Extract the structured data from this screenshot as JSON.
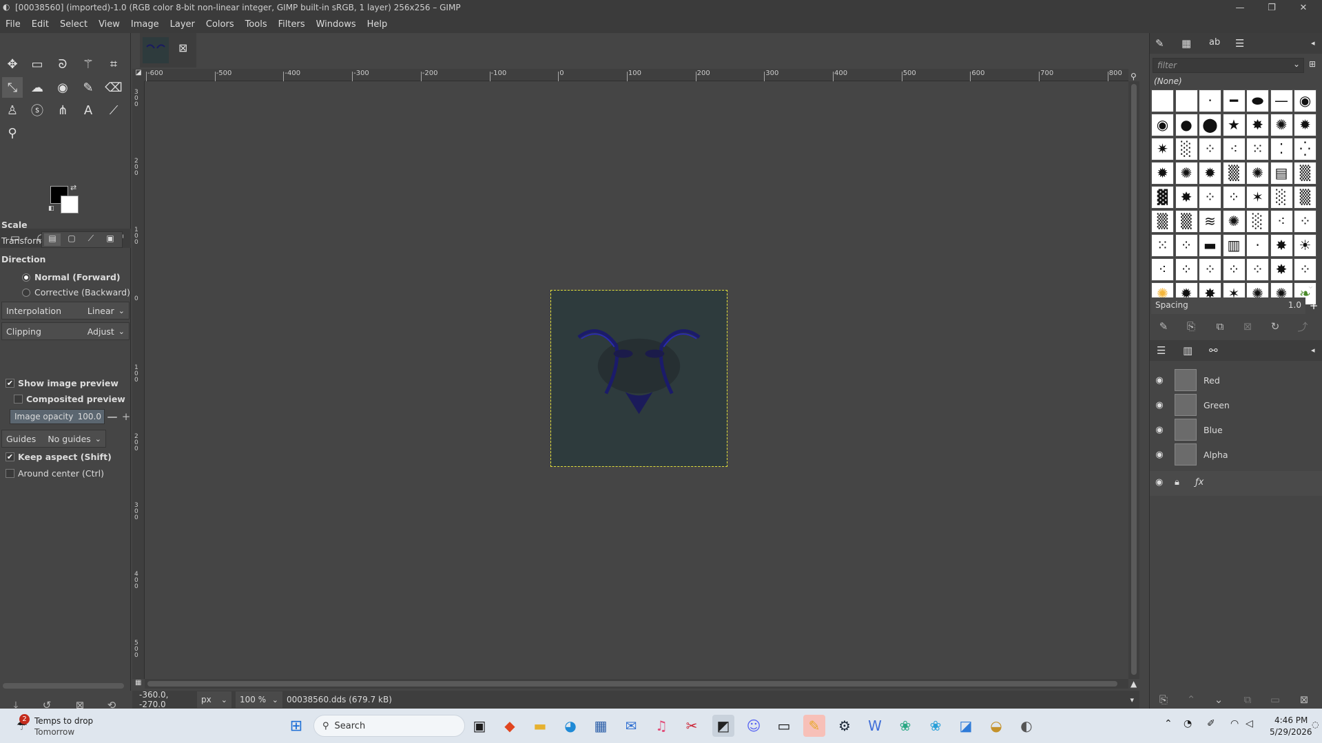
{
  "window": {
    "title": "[00038560] (imported)-1.0 (RGB color 8-bit non-linear integer, GIMP built-in sRGB, 1 layer) 256x256 – GIMP",
    "minimize": "—",
    "maximize": "❐",
    "close": "✕"
  },
  "menu": [
    "File",
    "Edit",
    "Select",
    "View",
    "Image",
    "Layer",
    "Colors",
    "Tools",
    "Filters",
    "Windows",
    "Help"
  ],
  "tool_options": {
    "title": "Scale",
    "transform_label": "Transform:",
    "direction_label": "Direction",
    "direction_normal": "Normal (Forward)",
    "direction_corrective": "Corrective (Backward)",
    "interpolation_label": "Interpolation",
    "interpolation_value": "Linear",
    "clipping_label": "Clipping",
    "clipping_value": "Adjust",
    "show_preview": "Show image preview",
    "composited_preview": "Composited preview",
    "image_opacity_label": "Image opacity",
    "image_opacity_value": "100.0",
    "guides_label": "Guides",
    "guides_value": "No guides",
    "keep_aspect": "Keep aspect (Shift)",
    "around_center": "Around center (Ctrl)"
  },
  "ruler": {
    "h_labels": [
      "-600",
      "-500",
      "-400",
      "-300",
      "-200",
      "-100",
      "0",
      "100",
      "200",
      "300",
      "400",
      "500",
      "600",
      "700",
      "800"
    ],
    "v_labels": [
      "300",
      "200",
      "100",
      "0",
      "100",
      "200",
      "300",
      "400",
      "500"
    ]
  },
  "status": {
    "coords": "-360.0, -270.0",
    "unit": "px",
    "zoom": "100 %",
    "file": "00038560.dds (679.7 kB)"
  },
  "brushes": {
    "filter_placeholder": "filter",
    "selected": "(None)",
    "spacing_label": "Spacing",
    "spacing_value": "1.0"
  },
  "layers": [
    {
      "name": "Red"
    },
    {
      "name": "Green"
    },
    {
      "name": "Blue"
    },
    {
      "name": "Alpha"
    }
  ],
  "taskbar": {
    "weather_title": "Temps to drop",
    "weather_sub": "Tomorrow",
    "weather_badge": "2",
    "search_placeholder": "Search",
    "time": "4:46 PM",
    "date": "5/29/2026"
  },
  "colors": {
    "canvas_image_bg": "#2e3b3d",
    "accent": "#1d6fd6"
  }
}
